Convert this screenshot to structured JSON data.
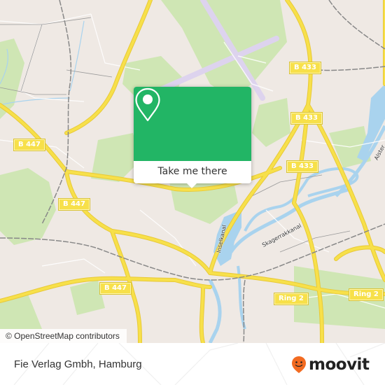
{
  "map": {
    "attribution": "© OpenStreetMap contributors",
    "road_labels": [
      {
        "id": "b447-nw",
        "text": "B 447"
      },
      {
        "id": "b447-w",
        "text": "B 447"
      },
      {
        "id": "b447-sw",
        "text": "B 447"
      },
      {
        "id": "b433-n",
        "text": "B 433"
      },
      {
        "id": "b433-mid",
        "text": "B 433"
      },
      {
        "id": "b433-s",
        "text": "B 433"
      },
      {
        "id": "ring2-w",
        "text": "Ring 2"
      },
      {
        "id": "ring2-e",
        "text": "Ring 2"
      }
    ],
    "water_labels": [
      {
        "id": "inselkanal",
        "text": "Inselkanal"
      },
      {
        "id": "skagerrakkanal",
        "text": "Skagerrakkanal"
      },
      {
        "id": "alster",
        "text": "Alster"
      }
    ],
    "colors": {
      "land": "#efe9e4",
      "park": "#cfe6b4",
      "water": "#a9d3ee",
      "road_major": "#f7e04a",
      "rail": "#888888",
      "runway": "#ddd3ee"
    }
  },
  "popup": {
    "icon": "location-pin-icon",
    "action_label": "Take me there",
    "accent_color": "#22b565"
  },
  "footer": {
    "place_name": "Fie Verlag Gmbh, Hamburg",
    "brand": {
      "name": "moovit",
      "icon": "moovit-smiley-pin-icon",
      "icon_color": "#f26b21"
    }
  }
}
